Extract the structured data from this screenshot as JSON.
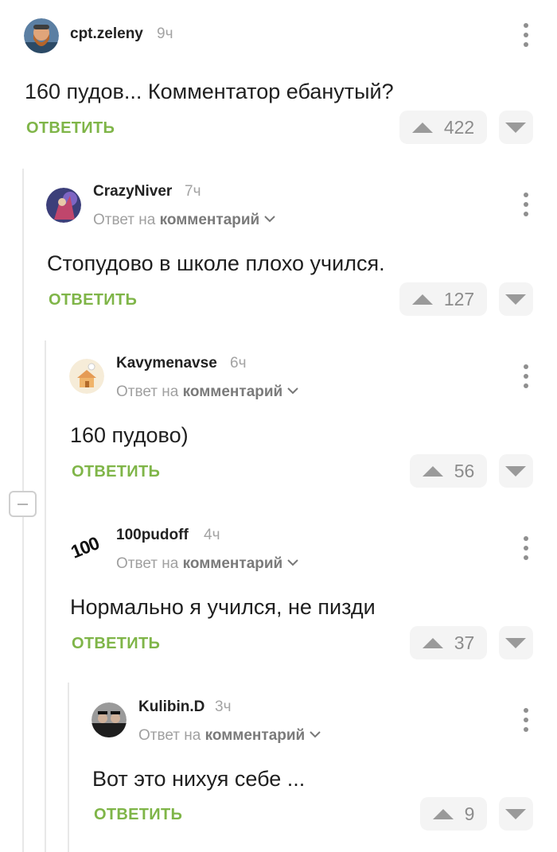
{
  "comments": [
    {
      "username": "cpt.zeleny",
      "time": "9ч",
      "text": "160 пудов... Комментатор ебанутый?",
      "reply_label": "ОТВЕТИТЬ",
      "votes": "422",
      "avatar_icon": "bearded-man-avatar"
    },
    {
      "username": "CrazyNiver",
      "time": "7ч",
      "reply_to_prefix": "Ответ на",
      "reply_to_target": "комментарий",
      "text": "Стопудово в школе плохо учился.",
      "reply_label": "ОТВЕТИТЬ",
      "votes": "127",
      "avatar_icon": "fantasy-character-avatar"
    },
    {
      "username": "Kavymenavse",
      "time": "6ч",
      "reply_to_prefix": "Ответ на",
      "reply_to_target": "комментарий",
      "text": "160 пудово)",
      "reply_label": "ОТВЕТИТЬ",
      "votes": "56",
      "avatar_icon": "cartoon-house-avatar"
    },
    {
      "username": "100pudoff",
      "time": "4ч",
      "reply_to_prefix": "Ответ на",
      "reply_to_target": "комментарий",
      "text": "Нормально я учился, не пизди",
      "reply_label": "ОТВЕТИТЬ",
      "votes": "37",
      "avatar_text": "100"
    },
    {
      "username": "Kulibin.D",
      "time": "3ч",
      "reply_to_prefix": "Ответ на",
      "reply_to_target": "комментарий",
      "text": "Вот это нихуя себе ...",
      "reply_label": "ОТВЕТИТЬ",
      "votes": "9",
      "avatar_icon": "men-in-suits-avatar"
    }
  ],
  "colors": {
    "reply_accent": "#7fb548",
    "vote_bg": "#f4f4f4",
    "muted_text": "#a3a3a3"
  }
}
